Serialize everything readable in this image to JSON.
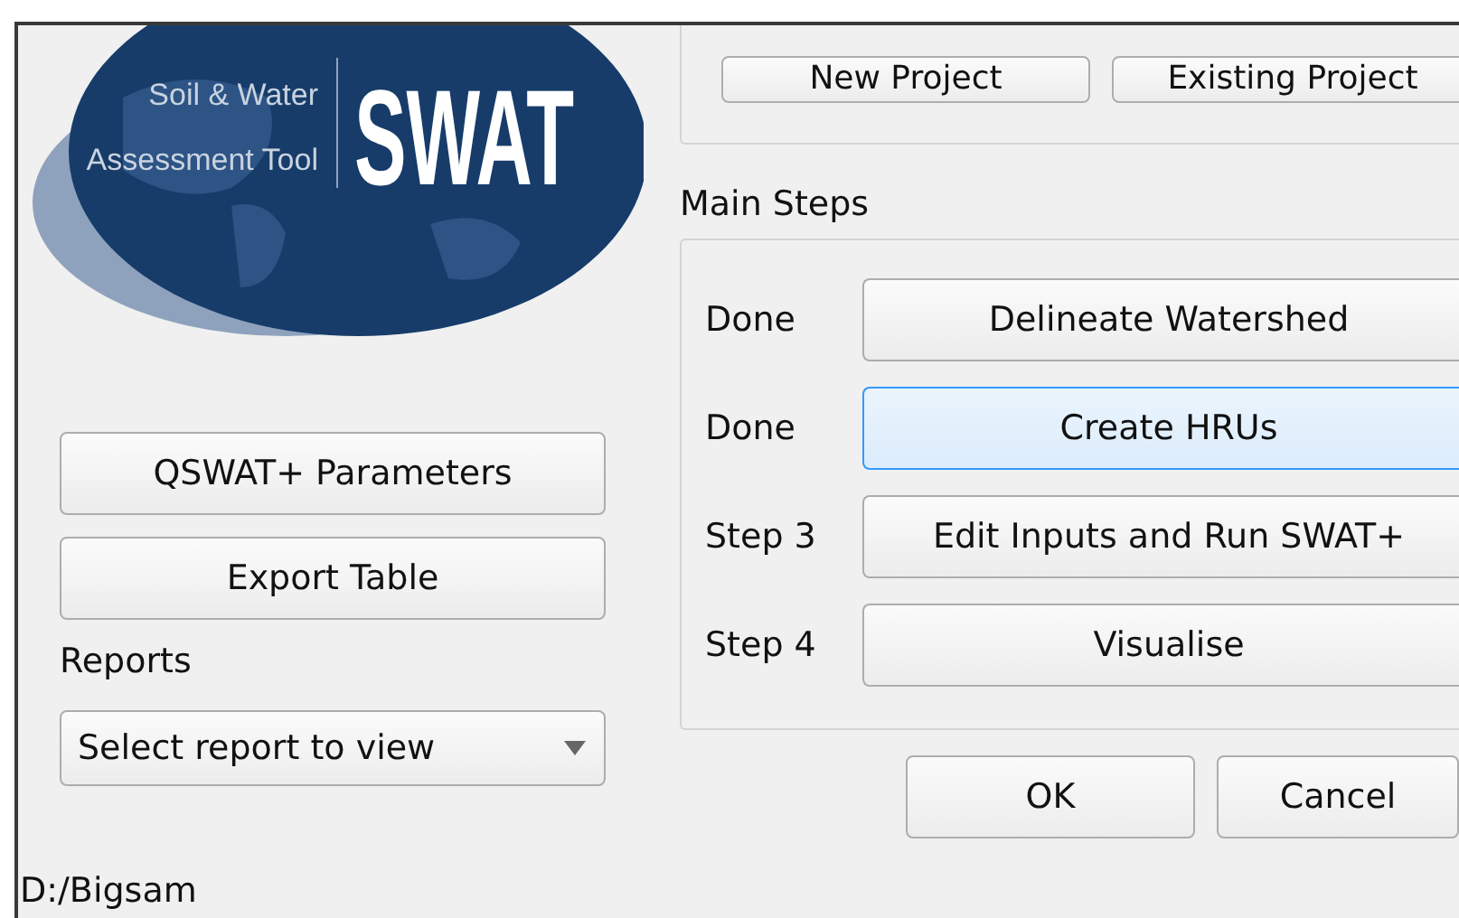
{
  "logo": {
    "subtitle_lines": [
      "Soil & Water",
      "Assessment Tool"
    ],
    "title": "SWAT"
  },
  "project_buttons": [
    "New Project",
    "Existing Project"
  ],
  "left_buttons": [
    "QSWAT+ Parameters",
    "Export Table"
  ],
  "reports": {
    "label": "Reports",
    "select": "Select report to view"
  },
  "main_steps": {
    "title": "Main Steps",
    "steps": [
      {
        "status": "Done",
        "action": "Delineate Watershed",
        "focused": false
      },
      {
        "status": "Done",
        "action": "Create HRUs",
        "focused": true
      },
      {
        "status": "Step 3",
        "action": "Edit Inputs and Run SWAT+",
        "focused": false
      },
      {
        "status": "Step 4",
        "action": "Visualise",
        "focused": false
      }
    ]
  },
  "dialog_buttons": [
    "OK",
    "Cancel"
  ],
  "status_path": "D:/Bigsam"
}
